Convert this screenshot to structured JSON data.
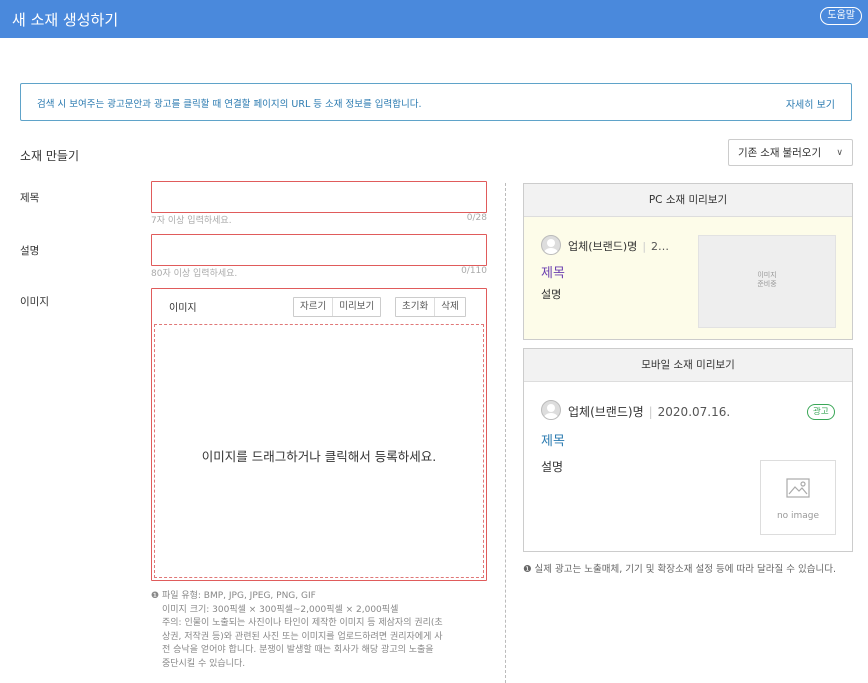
{
  "header": {
    "title": "새 소재 생성하기",
    "help_label": "도움말"
  },
  "notice": {
    "message": "검색 시 보여주는 광고문안과 광고를 클릭할 때 연결할 페이지의 URL 등 소재 정보를 입력합니다.",
    "more_link": "자세히 보기"
  },
  "section_title": "소재 만들기",
  "load_button": {
    "label": "기존 소재 불러오기",
    "icon": "chevron-down-icon"
  },
  "form": {
    "title_label": "제목",
    "title_value": "",
    "title_hint": "7자 이상 입력하세요.",
    "title_count": "0/28",
    "desc_label": "설명",
    "desc_value": "",
    "desc_hint": "80자 이상 입력하세요.",
    "desc_count": "0/110",
    "image_label": "이미지",
    "image_tab": "이미지",
    "tools": [
      "자르기",
      "미리보기",
      "초기화",
      "삭제"
    ],
    "drop_text": "이미지를 드래그하거나 클릭해서 등록하세요.",
    "file_info": [
      "파일 유형: BMP, JPG, JPEG, PNG, GIF",
      "이미지 크기: 300픽셀 × 300픽셀~2,000픽셀 × 2,000픽셀",
      "주의: 인물이 노출되는 사진이나 타인이 제작한 이미지 등 제삼자의 권리(초",
      "상권, 저작권 등)와 관련된 사진 또는 이미지를 업로드하려면 권리자에게 사",
      "전 승낙을 얻어야 합니다. 분쟁이 발생할 때는 회사가 해당 광고의 노출을",
      "중단시킬 수 있습니다."
    ]
  },
  "pc_preview": {
    "heading": "PC 소재 미리보기",
    "brand": "업체(브랜드)명",
    "date_truncated": "2…",
    "title": "제목",
    "desc": "설명",
    "thumb_line1": "이미지",
    "thumb_line2": "준비중"
  },
  "mobile_preview": {
    "heading": "모바일 소재 미리보기",
    "brand": "업체(브랜드)명",
    "date": "2020.07.16.",
    "badge": "광고",
    "title": "제목",
    "desc": "설명",
    "noimage": "no image"
  },
  "footnote": "실제 광고는 노출매체, 기기 및 확장소재 설정 등에 따라 달라질 수 있습니다.",
  "colors": {
    "header_bg": "#4a89dc",
    "error_border": "#e05b5b",
    "link": "#2a7ab0",
    "ad_badge": "#3aa757"
  }
}
